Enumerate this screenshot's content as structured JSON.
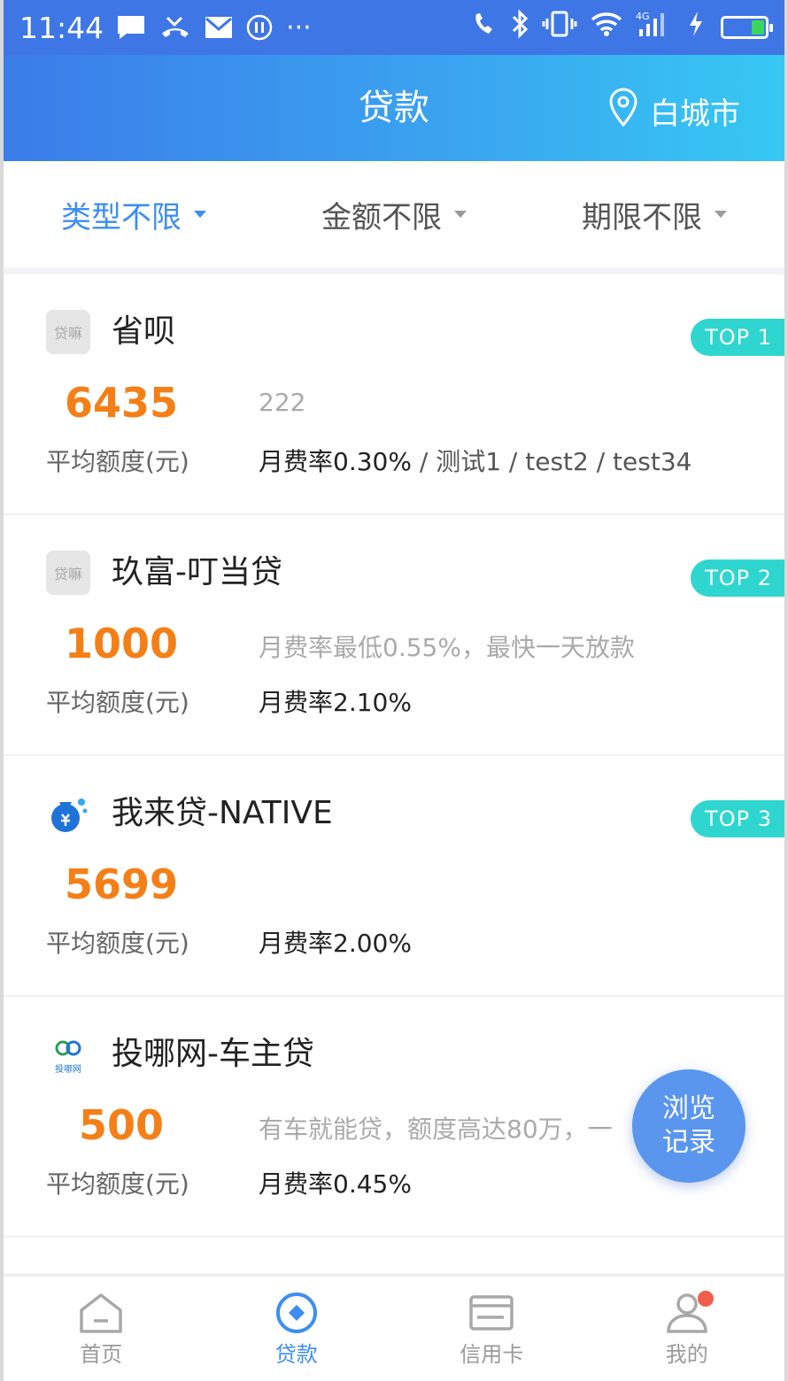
{
  "status_bar": {
    "time": "11:44",
    "more": "···"
  },
  "header": {
    "title": "贷款",
    "location": "白城市"
  },
  "filters": [
    {
      "label": "类型不限",
      "active": true
    },
    {
      "label": "金额不限",
      "active": false
    },
    {
      "label": "期限不限",
      "active": false
    }
  ],
  "products": [
    {
      "logo_text": "贷嘛",
      "name": "省呗",
      "badge": "TOP 1",
      "amount": "6435",
      "amount_label": "平均额度(元)",
      "desc": "222",
      "rate": "月费率0.30%",
      "tags": " / 测试1 / test2 / test34"
    },
    {
      "logo_text": "贷嘛",
      "name": "玖富-叮当贷",
      "badge": "TOP 2",
      "amount": "1000",
      "amount_label": "平均额度(元)",
      "desc": "月费率最低0.55%，最快一天放款",
      "rate": "月费率2.10%",
      "tags": ""
    },
    {
      "logo_text": "",
      "name": "我来贷-NATIVE",
      "badge": "TOP 3",
      "amount": "5699",
      "amount_label": "平均额度(元)",
      "desc": "",
      "rate": "月费率2.00%",
      "tags": ""
    },
    {
      "logo_text": "投哪网",
      "name": "投哪网-车主贷",
      "badge": "",
      "amount": "500",
      "amount_label": "平均额度(元)",
      "desc": "有车就能贷，额度高达80万，一",
      "rate": "月费率0.45%",
      "tags": ""
    }
  ],
  "float_button": {
    "label": "浏览记录"
  },
  "tabs": [
    {
      "label": "首页",
      "icon": "home-icon",
      "active": false
    },
    {
      "label": "贷款",
      "icon": "loan-icon",
      "active": true
    },
    {
      "label": "信用卡",
      "icon": "credit-card-icon",
      "active": false
    },
    {
      "label": "我的",
      "icon": "profile-icon",
      "active": false,
      "has_dot": true
    }
  ],
  "colors": {
    "primary": "#3d8ef0",
    "amount": "#f57f17",
    "badge": "#2fd6d0",
    "notify_dot": "#f25c4a"
  }
}
